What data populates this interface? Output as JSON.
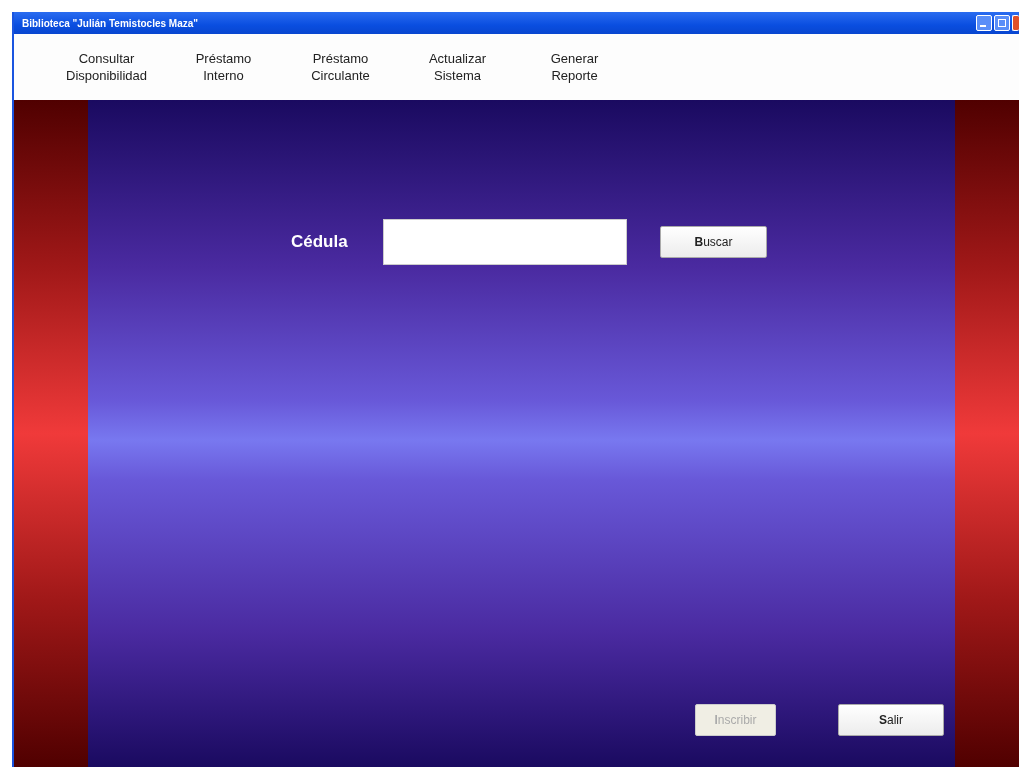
{
  "window": {
    "title": "Biblioteca \"Julián Temistocles Maza\""
  },
  "menu": [
    {
      "label": "Consultar\nDisponibilidad"
    },
    {
      "label": "Préstamo\nInterno"
    },
    {
      "label": "Préstamo\nCirculante"
    },
    {
      "label": "Actualizar\nSistema"
    },
    {
      "label": "Generar\nReporte"
    }
  ],
  "search": {
    "label": "Cédula",
    "button": "**B**uscar"
  },
  "buttons": [
    {
      "label": "**I**nscribir",
      "disabled": true
    },
    {
      "label": "**S**alir",
      "disabled": false
    }
  ]
}
